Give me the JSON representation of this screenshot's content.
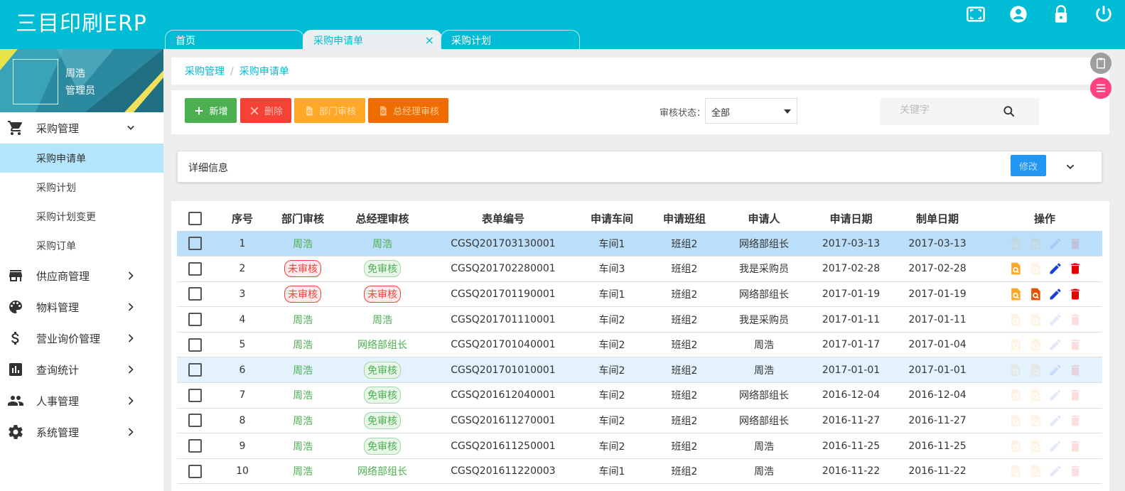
{
  "app": {
    "title": "三目印刷ERP"
  },
  "tabs": [
    {
      "label": "首页",
      "active": false
    },
    {
      "label": "采购申请单",
      "active": true,
      "close": "×"
    },
    {
      "label": "采购计划",
      "active": false
    }
  ],
  "header_icons": [
    "fullscreen-icon",
    "account-circle-icon",
    "lock-icon",
    "power-icon"
  ],
  "user": {
    "name": "周浩",
    "role": "管理员"
  },
  "sidebar": {
    "menus": [
      {
        "label": "采购管理",
        "icon": "cart-icon",
        "expanded": true,
        "children": [
          {
            "label": "采购申请单",
            "active": true
          },
          {
            "label": "采购计划"
          },
          {
            "label": "采购计划变更"
          },
          {
            "label": "采购订单"
          }
        ]
      },
      {
        "label": "供应商管理",
        "icon": "store-icon"
      },
      {
        "label": "物料管理",
        "icon": "palette-icon"
      },
      {
        "label": "营业询价管理",
        "icon": "dollar-icon"
      },
      {
        "label": "查询统计",
        "icon": "chart-icon"
      },
      {
        "label": "人事管理",
        "icon": "people-icon"
      },
      {
        "label": "系统管理",
        "icon": "gear-icon"
      }
    ]
  },
  "breadcrumb": {
    "parent": "采购管理",
    "sep": "/",
    "current": "采购申请单"
  },
  "toolbar": {
    "add": "新增",
    "delete": "删除",
    "dept_audit": "部门审核",
    "gm_audit": "总经理审核",
    "filter_label": "审核状态：",
    "filter_value": "全部",
    "search_placeholder": "关键字"
  },
  "detail": {
    "title": "详细信息",
    "edit": "修改"
  },
  "table": {
    "columns": [
      "序号",
      "部门审核",
      "总经理审核",
      "表单编号",
      "申请车间",
      "申请班组",
      "申请人",
      "申请日期",
      "制单日期",
      "操作"
    ],
    "rows": [
      {
        "no": "1",
        "dept": "周浩",
        "dept_type": "text",
        "gm": "周浩",
        "gm_type": "text",
        "code": "CGSQ201703130001",
        "workshop": "车间1",
        "team": "班组2",
        "applicant": "网络部组长",
        "apply_date": "2017-03-13",
        "make_date": "2017-03-13",
        "ops_enabled": false,
        "state": "sel"
      },
      {
        "no": "2",
        "dept": "未审核",
        "dept_type": "red",
        "gm": "免审核",
        "gm_type": "green",
        "code": "CGSQ201702280001",
        "workshop": "车间3",
        "team": "班组2",
        "applicant": "我是采购员",
        "apply_date": "2017-02-28",
        "make_date": "2017-02-28",
        "ops_enabled": true,
        "gm_op": false,
        "state": ""
      },
      {
        "no": "3",
        "dept": "未审核",
        "dept_type": "red",
        "gm": "未审核",
        "gm_type": "red",
        "code": "CGSQ201701190001",
        "workshop": "车间1",
        "team": "班组2",
        "applicant": "网络部组长",
        "apply_date": "2017-01-19",
        "make_date": "2017-01-19",
        "ops_enabled": true,
        "gm_op": true,
        "state": ""
      },
      {
        "no": "4",
        "dept": "周浩",
        "dept_type": "text",
        "gm": "周浩",
        "gm_type": "text",
        "code": "CGSQ201701110001",
        "workshop": "车间2",
        "team": "班组2",
        "applicant": "我是采购员",
        "apply_date": "2017-01-11",
        "make_date": "2017-01-11",
        "ops_enabled": false,
        "state": ""
      },
      {
        "no": "5",
        "dept": "周浩",
        "dept_type": "text",
        "gm": "网络部组长",
        "gm_type": "text",
        "code": "CGSQ201701040001",
        "workshop": "车间2",
        "team": "班组2",
        "applicant": "周浩",
        "apply_date": "2017-01-17",
        "make_date": "2017-01-04",
        "ops_enabled": false,
        "state": ""
      },
      {
        "no": "6",
        "dept": "周浩",
        "dept_type": "text",
        "gm": "免审核",
        "gm_type": "green",
        "code": "CGSQ201701010001",
        "workshop": "车间2",
        "team": "班组2",
        "applicant": "周浩",
        "apply_date": "2017-01-01",
        "make_date": "2017-01-01",
        "ops_enabled": false,
        "state": "hover"
      },
      {
        "no": "7",
        "dept": "周浩",
        "dept_type": "text",
        "gm": "免审核",
        "gm_type": "green",
        "code": "CGSQ201612040001",
        "workshop": "车间2",
        "team": "班组2",
        "applicant": "网络部组长",
        "apply_date": "2016-12-04",
        "make_date": "2016-12-04",
        "ops_enabled": false,
        "state": ""
      },
      {
        "no": "8",
        "dept": "周浩",
        "dept_type": "text",
        "gm": "免审核",
        "gm_type": "green",
        "code": "CGSQ201611270001",
        "workshop": "车间2",
        "team": "班组2",
        "applicant": "网络部组长",
        "apply_date": "2016-11-27",
        "make_date": "2016-11-27",
        "ops_enabled": false,
        "state": ""
      },
      {
        "no": "9",
        "dept": "周浩",
        "dept_type": "text",
        "gm": "免审核",
        "gm_type": "green",
        "code": "CGSQ201611250001",
        "workshop": "车间2",
        "team": "班组2",
        "applicant": "周浩",
        "apply_date": "2016-11-25",
        "make_date": "2016-11-25",
        "ops_enabled": false,
        "state": ""
      },
      {
        "no": "10",
        "dept": "周浩",
        "dept_type": "text",
        "gm": "网络部组长",
        "gm_type": "text",
        "code": "CGSQ201611220003",
        "workshop": "车间1",
        "team": "班组2",
        "applicant": "周浩",
        "apply_date": "2016-11-22",
        "make_date": "2016-11-22",
        "ops_enabled": false,
        "state": ""
      }
    ]
  },
  "colors": {
    "primary": "#00bcd4",
    "add": "#4caf50",
    "delete": "#f44336",
    "dept": "#ffa726",
    "gm": "#ef6c00",
    "edit": "#2196f3"
  }
}
